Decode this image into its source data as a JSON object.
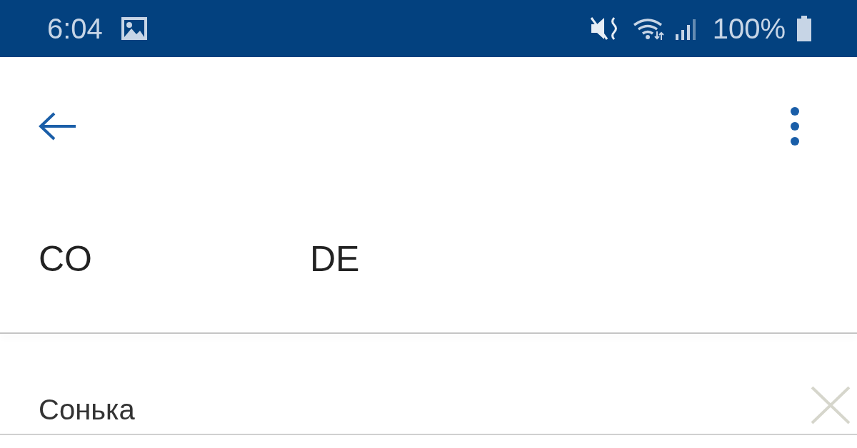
{
  "status_bar": {
    "time": "6:04",
    "battery": "100%"
  },
  "languages": [
    {
      "label": "CO"
    },
    {
      "label": "DE"
    }
  ],
  "input": {
    "value": "Сонька"
  }
}
